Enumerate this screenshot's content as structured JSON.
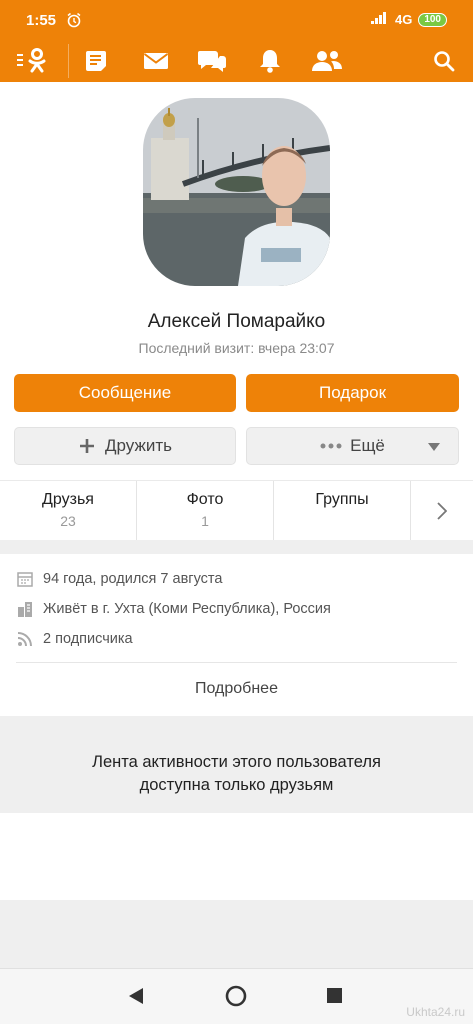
{
  "status_bar": {
    "time": "1:55",
    "network": "4G",
    "battery": "100"
  },
  "profile": {
    "name": "Алексей Помарайко",
    "last_visit": "Последний визит: вчера 23:07"
  },
  "actions": {
    "message": "Сообщение",
    "gift": "Подарок",
    "add_friend": "Дружить",
    "more": "Ещё"
  },
  "tabs": [
    {
      "label": "Друзья",
      "count": "23"
    },
    {
      "label": "Фото",
      "count": "1"
    },
    {
      "label": "Группы",
      "count": ""
    }
  ],
  "info": {
    "age": "94 года, родился 7 августа",
    "location": "Живёт в г. Ухта (Коми Республика), Россия",
    "followers": "2 подписчика"
  },
  "more_link": "Подробнее",
  "feed_notice": {
    "line1": "Лента активности этого пользователя",
    "line2": "доступна только друзьям"
  },
  "watermark": "Ukhta24.ru",
  "colors": {
    "accent": "#ee8208",
    "background": "#ffffff",
    "panel": "#efefef"
  }
}
